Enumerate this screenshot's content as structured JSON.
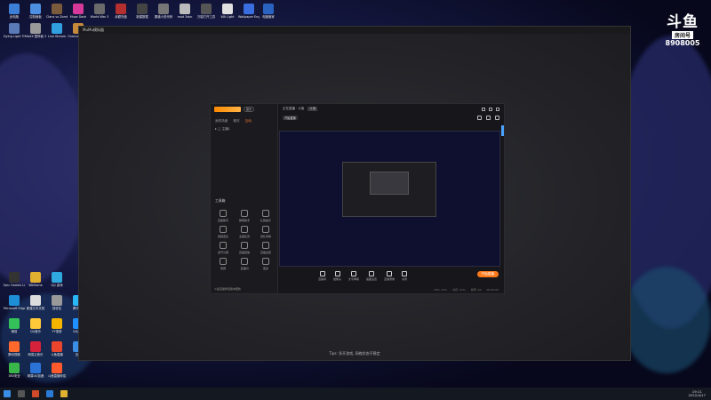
{
  "desktop": {
    "badge": {
      "logo": "斗鱼",
      "sub": "房间号",
      "room": "8908005"
    },
    "icons": [
      {
        "label": "此电脑",
        "color": "#3d7fd6"
      },
      {
        "label": "控制面板",
        "color": "#4d8fe0"
      },
      {
        "label": "Clans vs Zombies",
        "color": "#7a5a3a"
      },
      {
        "label": "Muse Dash",
        "color": "#d6399a"
      },
      {
        "label": "World War 3",
        "color": "#6b6b6b"
      },
      {
        "label": "余额充值",
        "color": "#b52f2f"
      },
      {
        "label": "新建数据",
        "color": "#444"
      },
      {
        "label": "霸道小说代码",
        "color": "#777"
      },
      {
        "label": "mod 3abc",
        "color": "#bbb"
      },
      {
        "label": "万能打开工具",
        "color": "#555"
      },
      {
        "label": "WA Light",
        "color": "#e0e0e0"
      },
      {
        "label": "Wallpaper Engine",
        "color": "#3a6ee0"
      },
      {
        "label": "电脑管家",
        "color": "#2a62c2"
      },
      {
        "label": "Dying Light The Follow",
        "color": "#5a7ab8"
      },
      {
        "label": "MaXX 暂停者 3",
        "color": "#999"
      },
      {
        "label": "Live Stream",
        "color": "#30a0e0"
      },
      {
        "label": "Overcooked 2",
        "color": "#c78a3a"
      },
      {
        "label": "Epic Games Launcher",
        "color": "#333"
      },
      {
        "label": "WeGame",
        "color": "#e0b030"
      },
      {
        "label": "QQ 游戏",
        "color": "#2fa9e0"
      },
      {
        "label": "Microsoft Edge",
        "color": "#1e8fd6"
      },
      {
        "label": "新建文本文档",
        "color": "#ddd"
      },
      {
        "label": "回收站",
        "color": "#999"
      },
      {
        "label": "腾讯QQ",
        "color": "#29b6f6"
      },
      {
        "label": "微信",
        "color": "#35c159"
      },
      {
        "label": "QQ音乐",
        "color": "#ffc93a"
      },
      {
        "label": "YY语音",
        "color": "#f4b400"
      },
      {
        "label": "QQ游戏",
        "color": "#1e90ff"
      },
      {
        "label": "腾讯视频",
        "color": "#ff6a2c"
      },
      {
        "label": "网易云音乐",
        "color": "#d6223a"
      },
      {
        "label": "斗鱼直播",
        "color": "#e8452c"
      },
      {
        "label": "迅雷",
        "color": "#3a8ee6"
      },
      {
        "label": "360安全",
        "color": "#3ab54a"
      },
      {
        "label": "网易UU加速",
        "color": "#2b73d6"
      },
      {
        "label": "斗鱼直播伴侣",
        "color": "#ff5a2c"
      }
    ],
    "taskbar": {
      "time": "19:11",
      "date": "2022/4/17"
    }
  },
  "window": {
    "title": "MuMu模拟器",
    "tip": "Tips: 多开游戏, 网络状态不稳定"
  },
  "app": {
    "brand_tag": "官方",
    "tabs": [
      "我的场景",
      "素材",
      "互动"
    ],
    "scene_label": "主播1",
    "tools_heading": "工具箱",
    "tools": [
      "直播助手",
      "弹幕助手",
      "礼物提示",
      "视频连麦",
      "主播任务",
      "送礼特效",
      "多开分屏",
      "直播回放",
      "直播设置",
      "录屏",
      "直播间",
      "更多"
    ],
    "footer_text": "斗鱼直播伴侣版本更新",
    "top": {
      "title": "正在直播 · 斗鱼",
      "tag": "斗鱼"
    },
    "sub": {
      "button": "开始直播"
    },
    "controls": [
      "直播间",
      "摄像头",
      "文字弹幕",
      "画面设置",
      "直播录像",
      "关闭"
    ],
    "go_live_label": "开始直播",
    "status": [
      "CPU: 14%",
      "内存: 41%",
      "帧率: 60",
      "00:00:00"
    ]
  }
}
